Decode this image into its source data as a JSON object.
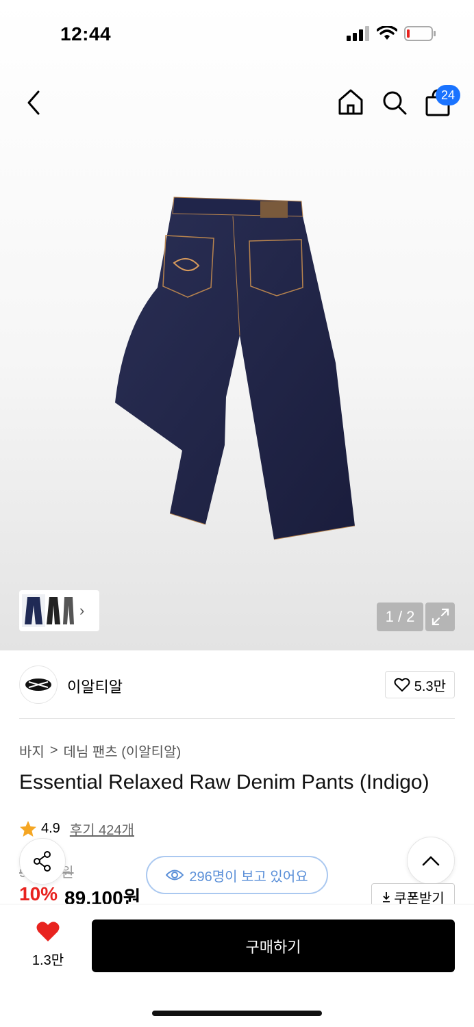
{
  "status": {
    "time": "12:44"
  },
  "nav": {
    "cart_count": "24"
  },
  "gallery": {
    "counter": "1 / 2"
  },
  "brand": {
    "name": "이알티알",
    "likes": "5.3만"
  },
  "breadcrumb": {
    "category": "바지",
    "separator": ">",
    "subcategory": "데님 팬츠 (이알티알)"
  },
  "product": {
    "title": "Essential Relaxed Raw Denim Pants (Indigo)",
    "rating": "4.9",
    "reviews": "후기 424개",
    "original_price": "99,000원",
    "discount": "10%",
    "price": "89,100원"
  },
  "viewers": "296명이 보고 있어요",
  "coupon_label": "쿠폰받기",
  "bottom": {
    "wish_count": "1.3만",
    "buy_label": "구매하기"
  },
  "colors": {
    "accent_blue": "#1a73ff",
    "sale_red": "#e8231f",
    "heart_red": "#e8231f",
    "star": "#f5a623"
  }
}
